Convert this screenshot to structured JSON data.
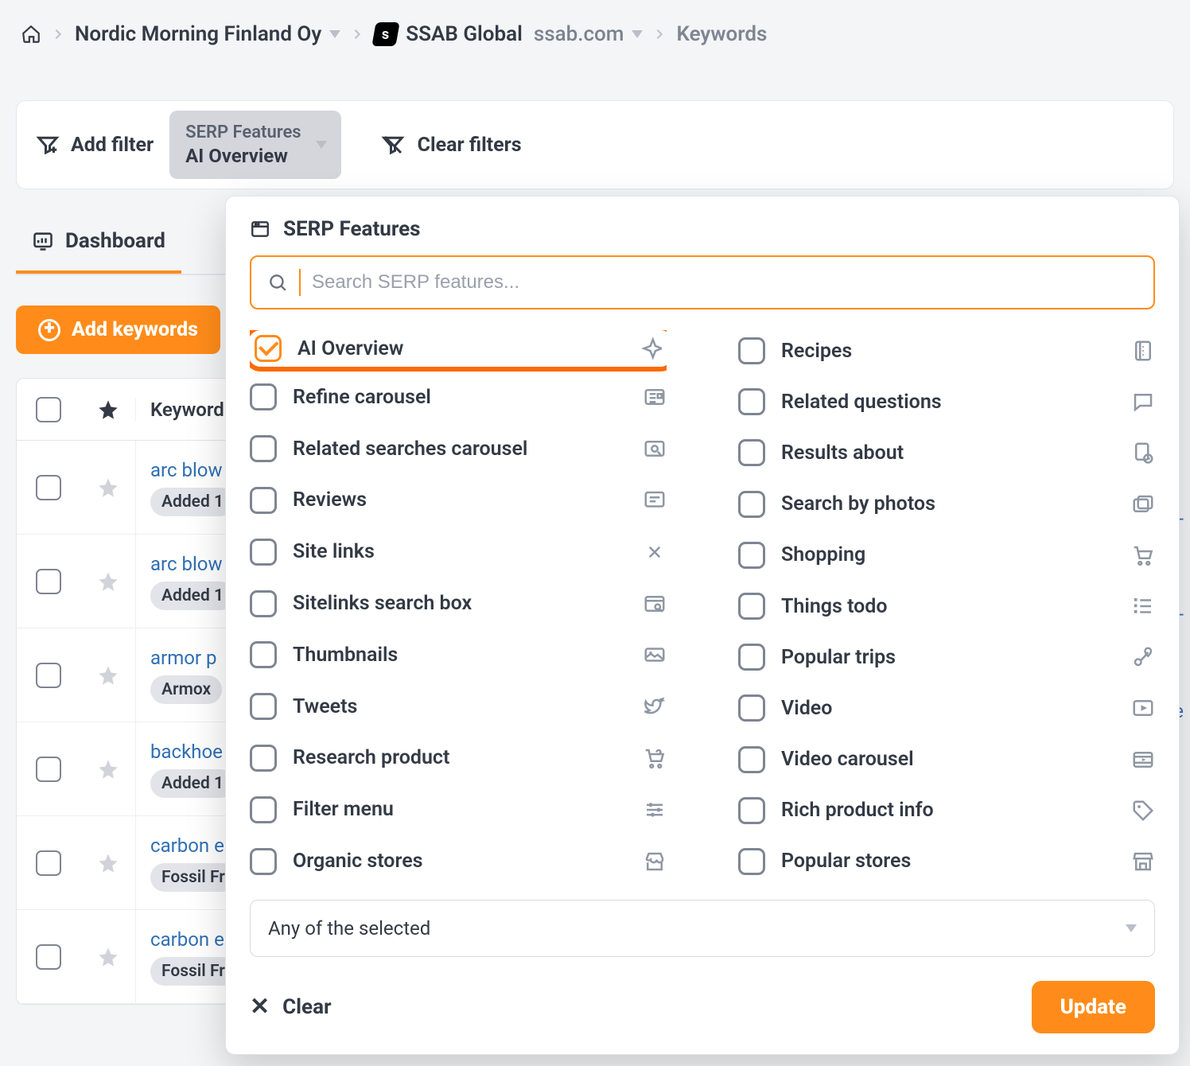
{
  "breadcrumb": {
    "org": "Nordic Morning Finland Oy",
    "project": "SSAB Global",
    "domain": "ssab.com",
    "section": "Keywords"
  },
  "filterbar": {
    "add_filter": "Add filter",
    "chip_title": "SERP Features",
    "chip_value": "AI Overview",
    "clear_filters": "Clear filters"
  },
  "tabs": {
    "dashboard": "Dashboard"
  },
  "add_keywords_label": "Add keywords",
  "table": {
    "header_keyword": "Keyword",
    "rows": [
      {
        "kw": "arc blow",
        "tag": "Added 1"
      },
      {
        "kw": "arc blow",
        "tag": "Added 1"
      },
      {
        "kw": "armor p",
        "tag": "Armox"
      },
      {
        "kw": "backhoe",
        "tag": "Added 1"
      },
      {
        "kw": "carbon e",
        "tag": "Fossil Fr"
      },
      {
        "kw": "carbon e",
        "tag": "Fossil Fr"
      }
    ]
  },
  "ghost_links": [
    "b-",
    "b-",
    "ee"
  ],
  "panel": {
    "title": "SERP Features",
    "search_placeholder": "Search SERP features...",
    "left": [
      {
        "label": "AI Overview",
        "checked": true,
        "icon": "sparkle"
      },
      {
        "label": "Refine carousel",
        "icon": "news"
      },
      {
        "label": "Related searches carousel",
        "icon": "lens-sq"
      },
      {
        "label": "Reviews",
        "icon": "review"
      },
      {
        "label": "Site links",
        "icon": "links"
      },
      {
        "label": "Sitelinks search box",
        "icon": "searchbox"
      },
      {
        "label": "Thumbnails",
        "icon": "thumb"
      },
      {
        "label": "Tweets",
        "icon": "bird"
      },
      {
        "label": "Research product",
        "icon": "cart-q"
      },
      {
        "label": "Filter menu",
        "icon": "sliders"
      },
      {
        "label": "Organic stores",
        "icon": "store"
      }
    ],
    "right": [
      {
        "label": "Recipes",
        "icon": "book"
      },
      {
        "label": "Related questions",
        "icon": "chat"
      },
      {
        "label": "Results about",
        "icon": "info-doc"
      },
      {
        "label": "Search by photos",
        "icon": "photos"
      },
      {
        "label": "Shopping",
        "icon": "cart"
      },
      {
        "label": "Things todo",
        "icon": "list"
      },
      {
        "label": "Popular trips",
        "icon": "pin-route"
      },
      {
        "label": "Video",
        "icon": "video"
      },
      {
        "label": "Video carousel",
        "icon": "video-c"
      },
      {
        "label": "Rich product info",
        "icon": "tag"
      },
      {
        "label": "Popular stores",
        "icon": "storefront"
      }
    ],
    "mode": "Any of the selected",
    "clear": "Clear",
    "update": "Update"
  }
}
